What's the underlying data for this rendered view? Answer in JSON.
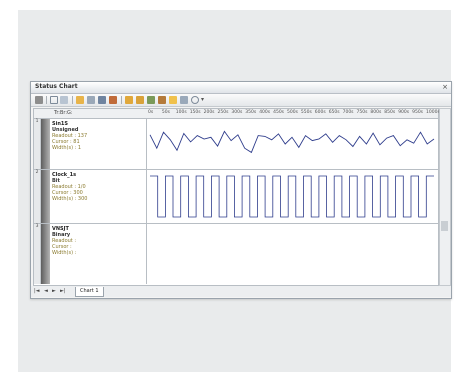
{
  "window": {
    "title": "Status Chart"
  },
  "grid": {
    "header_label": "Tr:Br:G:"
  },
  "ruler": {
    "labels": [
      "0s",
      "50s",
      "100s",
      "150s",
      "200s",
      "250s",
      "300s",
      "350s",
      "400s",
      "450s",
      "500s",
      "550s",
      "600s",
      "650s",
      "700s",
      "750s",
      "800s",
      "850s",
      "900s",
      "950s",
      "1000s"
    ]
  },
  "rows": [
    {
      "num": "1",
      "name": "Sin1S",
      "type": "Unsigned",
      "lines": [
        "Readout : 137",
        "Cursor : 81",
        "Width(s) : 1"
      ]
    },
    {
      "num": "2",
      "name": "Clock_1s",
      "type": "Bit",
      "lines": [
        "Readout : 1/0",
        "Cursor : 300",
        "Width(s) : 300"
      ]
    },
    {
      "num": "3",
      "name": "VNSJT",
      "type": "Binary",
      "lines": [
        "Readout :",
        "Cursor :",
        "Width(s) :"
      ]
    }
  ],
  "tabs": {
    "sheet_label": "Chart 1",
    "nav": [
      "|◄",
      "◄",
      "►",
      "►|"
    ]
  },
  "colors": {
    "trace": "#2f3d8c",
    "accent": "#8a7a2e"
  },
  "chart_data": {
    "type": "line",
    "series": [
      {
        "values": [
          72,
          40,
          78,
          60,
          35,
          75,
          55,
          70,
          62,
          66,
          45,
          80,
          58,
          72,
          40,
          30,
          70,
          68,
          60,
          74,
          50,
          66,
          42,
          70,
          58,
          62,
          74,
          54,
          70,
          60,
          44,
          68,
          50,
          76,
          48,
          64,
          70,
          46,
          60,
          52,
          78,
          50,
          62
        ]
      },
      {
        "values": [
          1,
          0,
          1,
          0,
          1,
          0,
          1,
          0,
          1,
          0,
          1,
          0,
          1,
          0,
          1,
          0,
          1,
          0,
          1,
          0,
          1,
          0,
          1,
          0,
          1,
          0,
          1,
          0,
          1,
          0,
          1,
          0,
          1,
          0,
          1,
          0,
          1
        ]
      }
    ]
  }
}
